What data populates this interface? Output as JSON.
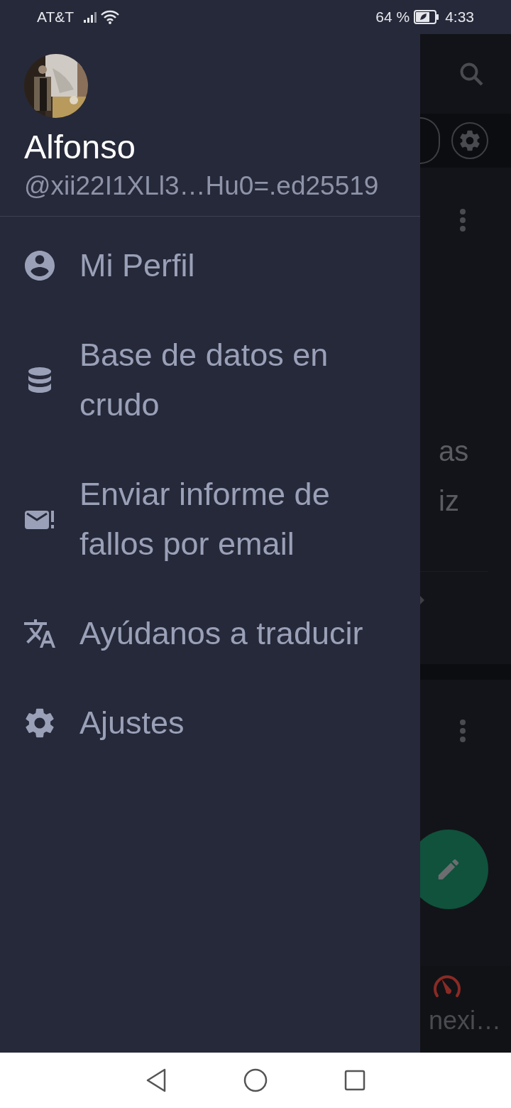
{
  "status_bar": {
    "carrier": "AT&T",
    "battery": "64 %",
    "time": "4:33"
  },
  "drawer": {
    "user": {
      "name": "Alfonso",
      "handle": "@xii22I1XLl3…Hu0=.ed25519"
    },
    "items": [
      {
        "kind": "profile",
        "label": "Mi Perfil"
      },
      {
        "kind": "database",
        "label": "Base de datos en crudo"
      },
      {
        "kind": "bug_report",
        "label": "Enviar informe de fallos por email"
      },
      {
        "kind": "translate",
        "label": "Ayúdanos a traducir"
      },
      {
        "kind": "settings",
        "label": "Ajustes"
      }
    ]
  },
  "background": {
    "card_1": [
      "as",
      "iz"
    ],
    "bottom_tab": "nexi…"
  }
}
